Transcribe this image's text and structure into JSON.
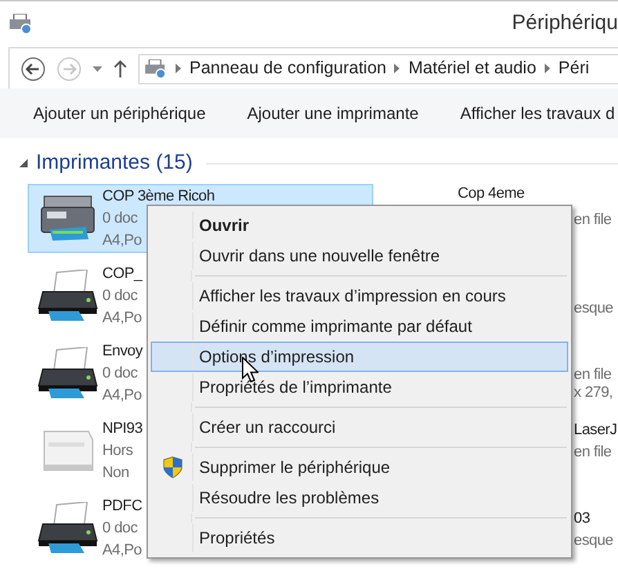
{
  "window": {
    "title": "Périphériqu"
  },
  "address_bar": {
    "back_disabled": false,
    "forward_disabled": true,
    "crumbs": [
      "Panneau de configuration",
      "Matériel et audio",
      "Péri"
    ]
  },
  "toolbar": [
    "Ajouter un périphérique",
    "Ajouter une imprimante",
    "Afficher les travaux d"
  ],
  "group": {
    "title": "Imprimantes (15)",
    "expanded": true
  },
  "printers": [
    {
      "name": "COP 3ème Ricoh",
      "line_2": "0 doc",
      "line_3": "A4,Po",
      "kind": "mfp",
      "selected": true
    },
    {
      "name": "COP_",
      "line_2": "0 doc",
      "line_3": "A4,Po",
      "kind": "inkjet",
      "selected": false
    },
    {
      "name": "Envoy",
      "line_2": "0 doc",
      "line_3": "A4,Po",
      "kind": "inkjet",
      "selected": false
    },
    {
      "name": "NPI93",
      "line_2": "Hors",
      "line_3": "Non",
      "kind": "laser",
      "selected": false
    },
    {
      "name": "PDFC",
      "line_2": "0 doc",
      "line_3": "A4,Po",
      "kind": "inkjet",
      "selected": false
    }
  ],
  "right_column": [
    {
      "text": "Cop 4eme",
      "kind": "name"
    },
    {
      "text": "en file",
      "kind": "detail"
    },
    {
      "text": "esque",
      "kind": "detail"
    },
    {
      "text": "en file",
      "kind": "detail"
    },
    {
      "text": "x 279,",
      "kind": "detail"
    },
    {
      "text": "LaserJ",
      "kind": "name"
    },
    {
      "text": "en file",
      "kind": "detail"
    },
    {
      "text": "03",
      "kind": "name"
    },
    {
      "text": "esque",
      "kind": "detail"
    }
  ],
  "context_menu": [
    {
      "label": "Ouvrir",
      "bold": true,
      "selected": false
    },
    {
      "label": "Ouvrir dans une nouvelle fenêtre",
      "bold": false,
      "selected": false,
      "separator_after": true
    },
    {
      "label": "Afficher les travaux d’impression en cours",
      "bold": false,
      "selected": false
    },
    {
      "label": "Définir comme imprimante par défaut",
      "bold": false,
      "selected": false
    },
    {
      "label": "Options d’impression",
      "bold": false,
      "selected": true
    },
    {
      "label": "Propriétés de l’imprimante",
      "bold": false,
      "selected": false,
      "separator_after": true
    },
    {
      "label": "Créer un raccourci",
      "bold": false,
      "selected": false,
      "separator_after": true
    },
    {
      "label": "Supprimer le périphérique",
      "bold": false,
      "selected": false,
      "shield": true
    },
    {
      "label": "Résoudre les problèmes",
      "bold": false,
      "selected": false,
      "separator_after": true
    },
    {
      "label": "Propriétés",
      "bold": false,
      "selected": false
    }
  ]
}
